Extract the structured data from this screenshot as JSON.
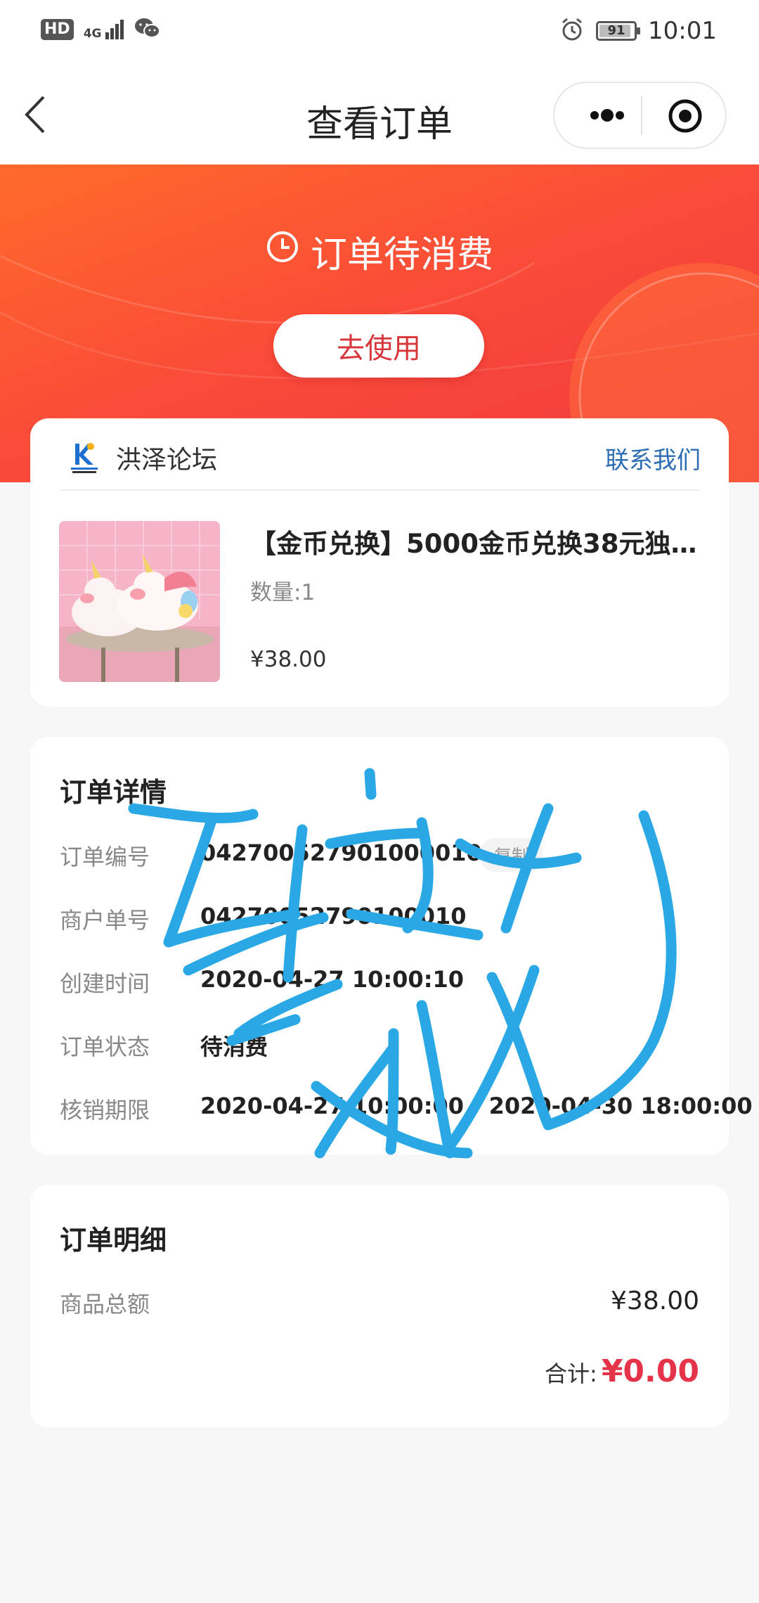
{
  "status_bar": {
    "hd": "HD",
    "network": "4G",
    "battery": "91",
    "time": "10:01"
  },
  "nav": {
    "title": "查看订单"
  },
  "hero": {
    "status_text": "订单待消费",
    "use_button": "去使用"
  },
  "shop": {
    "name": "洪泽论坛",
    "contact": "联系我们",
    "product": {
      "title": "【金币兑换】5000金币兑换38元独…",
      "quantity": "数量:1",
      "price": "¥38.00"
    }
  },
  "order_details": {
    "title": "订单详情",
    "copy_label": "复制",
    "rows": [
      {
        "label": "订单编号",
        "value": "0427005279010000101"
      },
      {
        "label": "商户单号",
        "value": "04270052790100010"
      },
      {
        "label": "创建时间",
        "value": "2020-04-27 10:00:10"
      },
      {
        "label": "订单状态",
        "value": "待消费"
      },
      {
        "label": "核销期限",
        "value": "2020-04-27 10:00:00 - 2020-04-30 18:00:00"
      }
    ]
  },
  "order_summary": {
    "title": "订单明细",
    "goods_total_label": "商品总额",
    "goods_total": "¥38.00",
    "total_label": "合计:",
    "total": "¥0.00"
  },
  "colors": {
    "hero_start": "#ff6a2b",
    "hero_end": "#f13b3d",
    "accent_red": "#e5344a",
    "link_blue": "#2d6db4",
    "scribble_blue": "#2aa8e6"
  }
}
